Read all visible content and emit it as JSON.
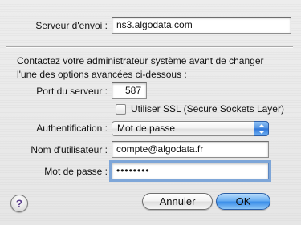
{
  "server": {
    "label": "Serveur d'envoi :",
    "value": "ns3.algodata.com"
  },
  "info_text": "Contactez votre administrateur système avant de changer l'une des options avancées ci-dessous :",
  "port": {
    "label": "Port du serveur :",
    "value": "587"
  },
  "ssl": {
    "label": "Utiliser SSL (Secure Sockets Layer)",
    "checked": false
  },
  "auth": {
    "label": "Authentification :",
    "selected": "Mot de passe"
  },
  "username": {
    "label": "Nom d'utilisateur :",
    "value": "compte@algodata.fr"
  },
  "password": {
    "label": "Mot de passe :",
    "value": "••••••••"
  },
  "buttons": {
    "help": "?",
    "cancel": "Annuler",
    "ok": "OK"
  },
  "colors": {
    "accent": "#3b8ee8",
    "focus_ring": "#7ea6d8"
  }
}
